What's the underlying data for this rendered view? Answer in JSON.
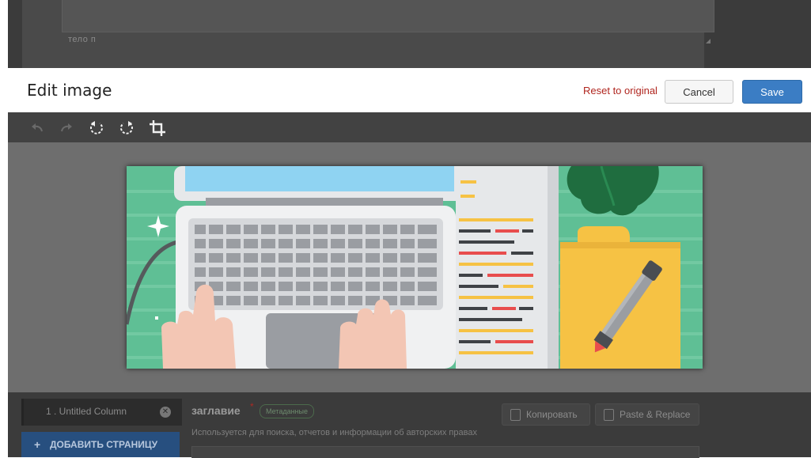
{
  "background": {
    "status_path": "тело  п"
  },
  "modal": {
    "title": "Edit image",
    "reset_label": "Reset to original",
    "cancel_label": "Cancel",
    "save_label": "Save"
  },
  "toolbar": {
    "tools": [
      {
        "icon": "undo-icon",
        "enabled": false
      },
      {
        "icon": "redo-icon",
        "enabled": false
      },
      {
        "icon": "rotate-left-icon",
        "enabled": true
      },
      {
        "icon": "rotate-right-icon",
        "enabled": true
      },
      {
        "icon": "crop-icon",
        "enabled": true
      }
    ]
  },
  "editor": {
    "column_tab_label": "1 . Untitled Column",
    "add_page_label": "ДОБАВИТЬ СТРАНИЦУ",
    "field_title": "заглавие",
    "field_required_mark": "*",
    "metadata_badge": "Метаданные",
    "field_help": "Используется для поиска, отчетов и информации об авторских правах",
    "copy_label": "Копировать",
    "paste_label": "Paste & Replace"
  },
  "colors": {
    "save": "#3b7dc4",
    "reset": "#b0261f",
    "image_bg": "#5fbf95",
    "folder": "#f6c244"
  }
}
